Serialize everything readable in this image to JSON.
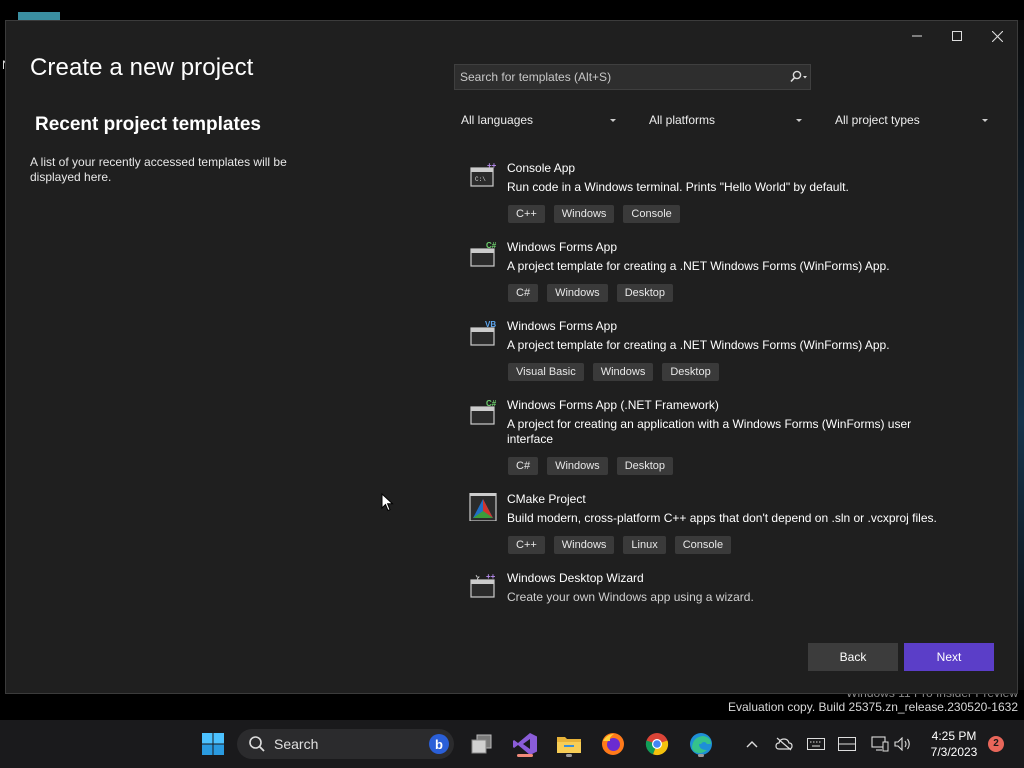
{
  "window": {
    "title": "Create a new project",
    "controls": {
      "minimize": "minimize",
      "maximize": "maximize",
      "close": "close"
    }
  },
  "recent": {
    "title": "Recent project templates",
    "description": "A list of your recently accessed templates will be displayed here."
  },
  "search": {
    "placeholder": "Search for templates (Alt+S)"
  },
  "filters": {
    "language": "All languages",
    "platform": "All platforms",
    "project_type": "All project types"
  },
  "templates": [
    {
      "name": "Console App",
      "description": "Run code in a Windows terminal. Prints \"Hello World\" by default.",
      "tags": [
        "C++",
        "Windows",
        "Console"
      ],
      "icon": "console-app-icon",
      "badge": "++"
    },
    {
      "name": "Windows Forms App",
      "description": "A project template for creating a .NET Windows Forms (WinForms) App.",
      "tags": [
        "C#",
        "Windows",
        "Desktop"
      ],
      "icon": "winforms-csharp-icon",
      "badge": "C#"
    },
    {
      "name": "Windows Forms App",
      "description": "A project template for creating a .NET Windows Forms (WinForms) App.",
      "tags": [
        "Visual Basic",
        "Windows",
        "Desktop"
      ],
      "icon": "winforms-vb-icon",
      "badge": "VB"
    },
    {
      "name": "Windows Forms App (.NET Framework)",
      "description": "A project for creating an application with a Windows Forms (WinForms) user interface",
      "tags": [
        "C#",
        "Windows",
        "Desktop"
      ],
      "icon": "winforms-framework-icon",
      "badge": "C#"
    },
    {
      "name": "CMake Project",
      "description": "Build modern, cross-platform C++ apps that don't depend on .sln or .vcxproj files.",
      "tags": [
        "C++",
        "Windows",
        "Linux",
        "Console"
      ],
      "icon": "cmake-icon"
    },
    {
      "name": "Windows Desktop Wizard",
      "description": "Create your own Windows app using a wizard.",
      "tags": [],
      "icon": "desktop-wizard-icon",
      "badge": "++"
    }
  ],
  "buttons": {
    "back": "Back",
    "next": "Next"
  },
  "watermark": {
    "line1": "Windows 11 Pro Insider Preview",
    "line2": "Evaluation copy. Build 25375.zn_release.230520-1632"
  },
  "taskbar": {
    "search_label": "Search",
    "time": "4:25 PM",
    "date": "7/3/2023",
    "notification_count": "2",
    "accent_color": "#5b3ec8"
  }
}
